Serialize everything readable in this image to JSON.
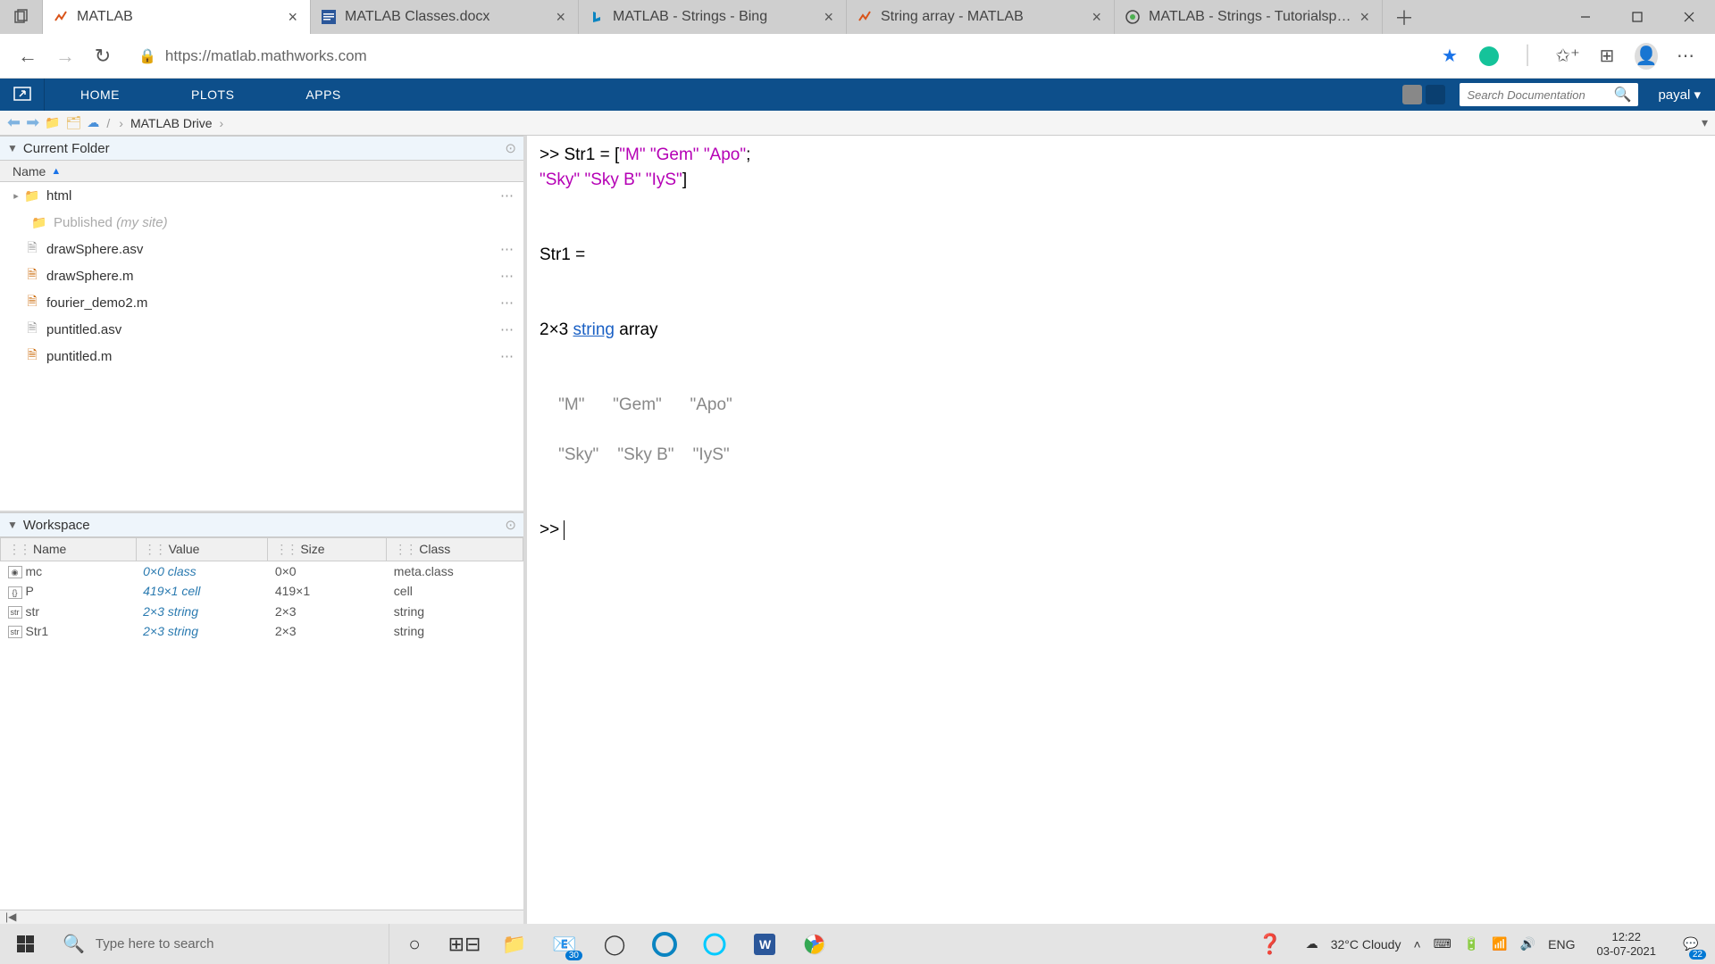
{
  "browser": {
    "tabs": [
      {
        "title": "MATLAB",
        "active": true
      },
      {
        "title": "MATLAB Classes.docx",
        "active": false
      },
      {
        "title": "MATLAB - Strings - Bing",
        "active": false
      },
      {
        "title": "String array - MATLAB",
        "active": false
      },
      {
        "title": "MATLAB - Strings - Tutorialspoint",
        "active": false
      }
    ],
    "url": "https://matlab.mathworks.com"
  },
  "ribbon": {
    "tabs": [
      "HOME",
      "PLOTS",
      "APPS"
    ],
    "search_placeholder": "Search Documentation",
    "user": "payal"
  },
  "path": {
    "root": "MATLAB Drive"
  },
  "folder": {
    "title": "Current Folder",
    "col": "Name",
    "items": [
      {
        "name": "html",
        "type": "folder",
        "expandable": true
      },
      {
        "name": "Published",
        "suffix": "(my site)",
        "type": "folder",
        "indent": true,
        "faded": true
      },
      {
        "name": "drawSphere.asv",
        "type": "file"
      },
      {
        "name": "drawSphere.m",
        "type": "mfile"
      },
      {
        "name": "fourier_demo2.m",
        "type": "mfile"
      },
      {
        "name": "puntitled.asv",
        "type": "file"
      },
      {
        "name": "puntitled.m",
        "type": "mfile"
      }
    ]
  },
  "workspace": {
    "title": "Workspace",
    "cols": [
      "Name",
      "Value",
      "Size",
      "Class"
    ],
    "rows": [
      {
        "name": "mc",
        "value": "0×0 class",
        "size": "0×0",
        "class": "meta.class"
      },
      {
        "name": "P",
        "value": "419×1 cell",
        "size": "419×1",
        "class": "cell"
      },
      {
        "name": "str",
        "value": "2×3 string",
        "size": "2×3",
        "class": "string"
      },
      {
        "name": "Str1",
        "value": "2×3 string",
        "size": "2×3",
        "class": "string"
      }
    ]
  },
  "cmd": {
    "line1_pre": ">> Str1 = [",
    "s1": "\"M\"",
    "s2": "\"Gem\"",
    "s3": "\"Apo\"",
    "line1_post": ";",
    "s4": "\"Sky\"",
    "s5": "\"Sky B\"",
    "s6": "\"IyS\"",
    "line2_post": "]",
    "out_var": "Str1 =",
    "out_dim_pre": "  2×3 ",
    "out_dim_link": "string",
    "out_dim_post": " array",
    "r1c1": "\"M\"",
    "r1c2": "\"Gem\"",
    "r1c3": "\"Apo\"",
    "r2c1": "\"Sky\"",
    "r2c2": "\"Sky B\"",
    "r2c3": "\"IyS\"",
    "prompt": ">> "
  },
  "taskbar": {
    "search_placeholder": "Type here to search",
    "weather": "32°C Cloudy",
    "lang": "ENG",
    "time": "12:22",
    "date": "03-07-2021",
    "mail_badge": "30",
    "notif_badge": "22"
  }
}
